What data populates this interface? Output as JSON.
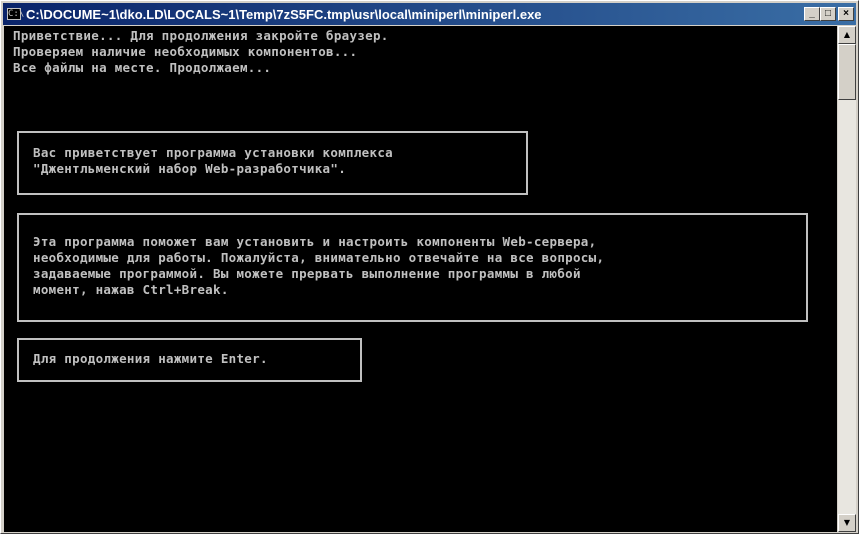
{
  "window": {
    "title": "C:\\DOCUME~1\\dko.LD\\LOCALS~1\\Temp\\7zS5FC.tmp\\usr\\local\\miniperl\\miniperl.exe",
    "system_icon": "C:\\",
    "minimize_glyph": "_",
    "maximize_glyph": "□",
    "close_glyph": "×"
  },
  "console": {
    "lines": [
      "Приветствие... Для продолжения закройте браузер.",
      "Проверяем наличие необходимых компонентов...",
      "Все файлы на месте. Продолжаем..."
    ],
    "box1": [
      "Вас приветствует программа установки комплекса",
      "\"Джентльменский набор Web-разработчика\"."
    ],
    "box2": [
      "Эта программа поможет вам установить и настроить компоненты Web-сервера,",
      "необходимые для работы. Пожалуйста, внимательно отвечайте на все вопросы,",
      "задаваемые программой. Вы можете прервать выполнение программы в любой",
      "момент, нажав Ctrl+Break."
    ],
    "box3": [
      "Для продолжения нажмите Enter."
    ]
  },
  "scrollbar": {
    "up_glyph": "▲",
    "down_glyph": "▼"
  },
  "colors": {
    "console_bg": "#000000",
    "console_text": "#c0c0c0",
    "titlebar": "#0a246a"
  }
}
